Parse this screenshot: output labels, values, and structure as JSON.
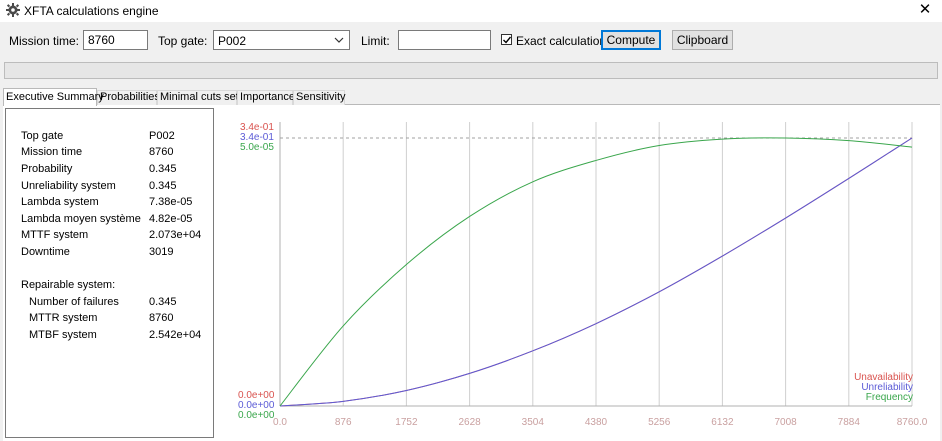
{
  "window": {
    "title": "XFTA calculations engine",
    "app_icon": "gear-icon",
    "close_icon": "close-icon",
    "close_glyph": "✕"
  },
  "toolbar": {
    "mission_time_label": "Mission time:",
    "mission_time_value": "8760",
    "top_gate_label": "Top gate:",
    "top_gate_value": "P002",
    "limit_label": "Limit:",
    "limit_value": "",
    "exact_label": "Exact calculation",
    "exact_checked": true,
    "compute_label": "Compute",
    "clipboard_label": "Clipboard"
  },
  "progress": {
    "value_percent": 0
  },
  "tabs": [
    {
      "label": "Executive Summary",
      "active": true
    },
    {
      "label": "Probabilities",
      "active": false
    },
    {
      "label": "Minimal cuts set",
      "active": false
    },
    {
      "label": "Importance",
      "active": false
    },
    {
      "label": "Sensitivity",
      "active": false
    }
  ],
  "summary": {
    "rows": [
      {
        "label": "Top gate",
        "value": "P002"
      },
      {
        "label": "Mission time",
        "value": "8760"
      },
      {
        "label": "Probability",
        "value": "0.345"
      },
      {
        "label": "Unreliability system",
        "value": "0.345"
      },
      {
        "label": "Lambda system",
        "value": "7.38e-05"
      },
      {
        "label": "Lambda moyen système",
        "value": "4.82e-05"
      },
      {
        "label": "MTTF system",
        "value": "2.073e+04"
      },
      {
        "label": "Downtime",
        "value": "3019"
      }
    ],
    "repairable_heading": "Repairable system:",
    "repairable_rows": [
      {
        "label": "Number of failures",
        "value": "0.345"
      },
      {
        "label": "MTTR system",
        "value": "8760"
      },
      {
        "label": "MTBF system",
        "value": "2.542e+04"
      }
    ]
  },
  "chart_data": {
    "type": "line",
    "x_ticks": [
      "0.0",
      "876",
      "1752",
      "2628",
      "3504",
      "4380",
      "5256",
      "6132",
      "7008",
      "7884",
      "8760.0"
    ],
    "xlim": [
      0,
      8760
    ],
    "y_top_labels": [
      {
        "text": "3.4e-01",
        "color": "#d9534f"
      },
      {
        "text": "3.4e-01",
        "color": "#5b5bd6"
      },
      {
        "text": "5.0e-05",
        "color": "#3aa64c"
      }
    ],
    "y_bottom_labels": [
      {
        "text": "0.0e+00",
        "color": "#d9534f"
      },
      {
        "text": "0.0e+00",
        "color": "#5b5bd6"
      },
      {
        "text": "0.0e+00",
        "color": "#3aa64c"
      }
    ],
    "series": [
      {
        "name": "Unavailability",
        "color": "#d9534f",
        "x": [
          0,
          876,
          1752,
          2628,
          3504,
          4380,
          5256,
          6132,
          7008,
          7884,
          8760
        ],
        "y": [
          0,
          0.006,
          0.02,
          0.042,
          0.071,
          0.106,
          0.147,
          0.193,
          0.242,
          0.293,
          0.345
        ]
      },
      {
        "name": "Unreliability",
        "color": "#5b5bd6",
        "x": [
          0,
          876,
          1752,
          2628,
          3504,
          4380,
          5256,
          6132,
          7008,
          7884,
          8760
        ],
        "y": [
          0,
          0.006,
          0.02,
          0.042,
          0.071,
          0.106,
          0.147,
          0.193,
          0.242,
          0.293,
          0.345
        ]
      },
      {
        "name": "Frequency",
        "color": "#3aa64c",
        "x": [
          0,
          876,
          1752,
          2628,
          3504,
          4380,
          5256,
          6132,
          7008,
          7884,
          8760
        ],
        "y": [
          0,
          1.5e-05,
          2.65e-05,
          3.55e-05,
          4.2e-05,
          4.6e-05,
          4.88e-05,
          5e-05,
          5.02e-05,
          4.97e-05,
          4.85e-05
        ]
      }
    ],
    "y_max": [
      0.345,
      0.345,
      5.02e-05
    ],
    "grid": true,
    "legend_position": "bottom-right"
  }
}
